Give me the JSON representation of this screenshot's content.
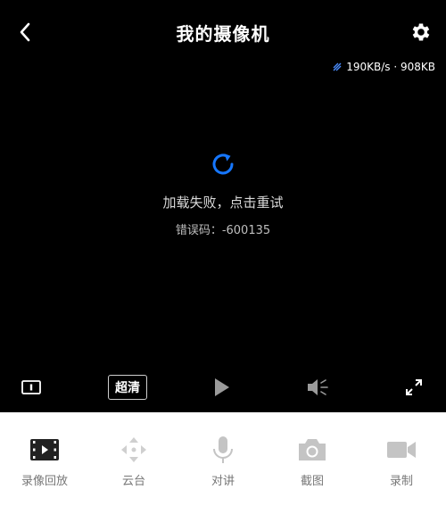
{
  "header": {
    "title": "我的摄像机"
  },
  "stream": {
    "speed": "190KB/s · 908KB"
  },
  "status": {
    "message": "加载失败，点击重试",
    "error_code": "错误码：-600135"
  },
  "controls": {
    "quality_label": "超清"
  },
  "toolbar": {
    "items": [
      {
        "label": "录像回放",
        "icon": "film-icon"
      },
      {
        "label": "云台",
        "icon": "dpad-icon"
      },
      {
        "label": "对讲",
        "icon": "microphone-icon"
      },
      {
        "label": "截图",
        "icon": "camera-icon"
      },
      {
        "label": "录制",
        "icon": "video-camera-icon"
      }
    ]
  },
  "colors": {
    "accent": "#1677ff",
    "background": "#000000",
    "toolbar_bg": "#ffffff",
    "disabled_icon": "#bdbdbd"
  }
}
